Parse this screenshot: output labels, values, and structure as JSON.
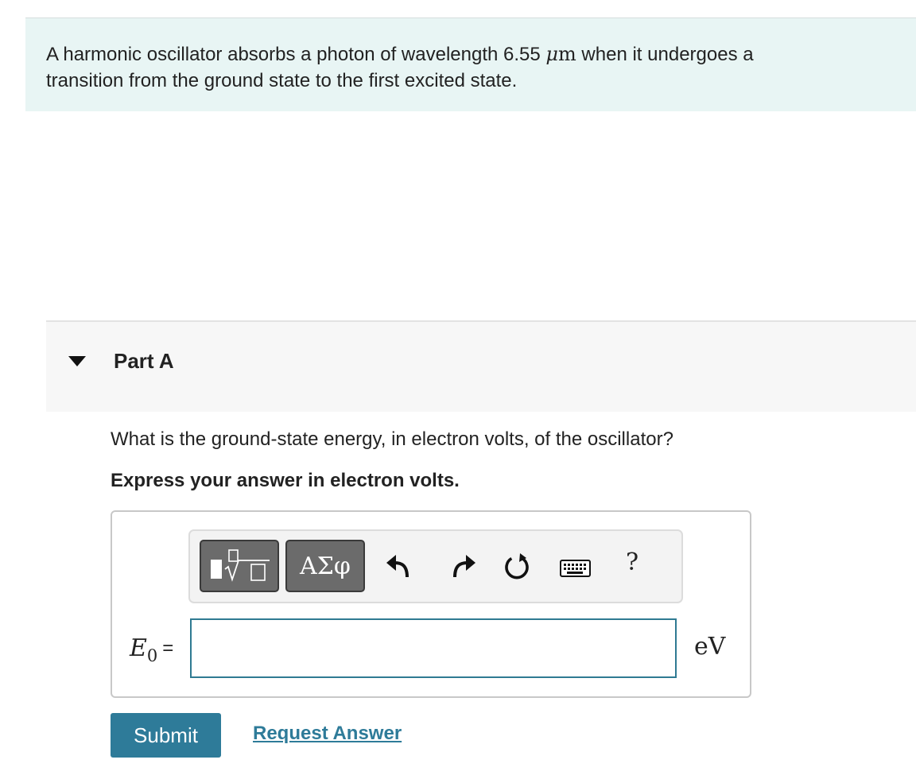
{
  "problem": {
    "text_before": "A harmonic oscillator absorbs a photon of wavelength 6.55 ",
    "unit_mu": "μ",
    "unit_m": "m",
    "text_line1_end": " when it undergoes a",
    "text_line2": "transition from the ground state to the first excited state."
  },
  "part": {
    "title": "Part A"
  },
  "question": "What is the ground-state energy, in electron volts, of the oscillator?",
  "instruction": "Express your answer in electron volts.",
  "toolbar": {
    "greek_label": "ΑΣφ",
    "help_label": "?"
  },
  "answer": {
    "variable_symbol": "E",
    "variable_subscript": "0",
    "equals": "=",
    "value": "",
    "unit": "eV"
  },
  "actions": {
    "submit_label": "Submit",
    "request_label": "Request Answer"
  }
}
